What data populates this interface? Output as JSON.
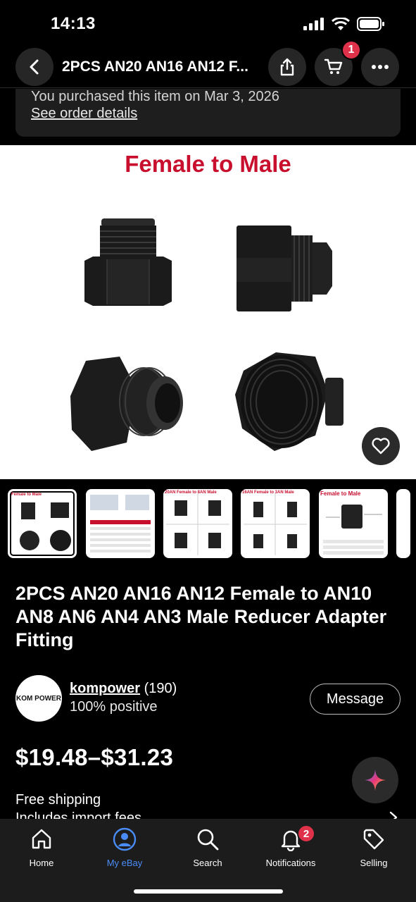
{
  "status": {
    "time": "14:13"
  },
  "header": {
    "title": "2PCS AN20 AN16 AN12 F...",
    "cart_count": "1"
  },
  "purchase": {
    "message": "You purchased this item on Mar 3, 2026",
    "link": "See order details"
  },
  "hero": {
    "caption": "Female to Male"
  },
  "thumbnails": [
    {
      "caption": "Female to Male"
    },
    {
      "caption": ""
    },
    {
      "caption": "20AN Female to 8AN Male"
    },
    {
      "caption": "16AN Female to 3AN Male"
    },
    {
      "caption": "Female to Male"
    }
  ],
  "product": {
    "title": "2PCS AN20 AN16 AN12 Female to AN10 AN8 AN6 AN4 AN3 Male Reducer Adapter Fitting"
  },
  "seller": {
    "logo_text": "KOM POWER",
    "name": "kompower",
    "count": "(190)",
    "positive": "100% positive",
    "message_label": "Message"
  },
  "price": "$19.48–$31.23",
  "shipping": {
    "line1": "Free shipping",
    "line2": "Includes import fees"
  },
  "tabs": [
    {
      "label": "Home",
      "icon": "home-icon"
    },
    {
      "label": "My eBay",
      "icon": "user-icon"
    },
    {
      "label": "Search",
      "icon": "search-icon"
    },
    {
      "label": "Notifications",
      "icon": "bell-icon"
    },
    {
      "label": "Selling",
      "icon": "tag-icon"
    }
  ],
  "notifications_count": "2",
  "colors": {
    "accent": "#4a8cf7",
    "badge": "#e0314b",
    "caption_red": "#c8102e"
  }
}
